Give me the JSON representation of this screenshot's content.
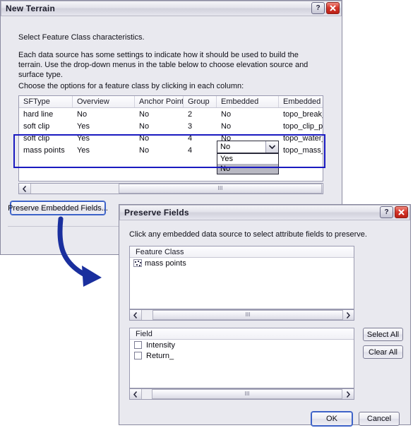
{
  "new_terrain": {
    "title": "New Terrain",
    "help_icon": "help-icon",
    "close_icon": "close-icon",
    "intro_line": "Select Feature Class characteristics.",
    "paragraph": "Each data source has some settings to indicate how it should be used to build the terrain.  Use the drop-down menus in the table below to choose elevation source and surface type.",
    "instruction": "Choose the options for a feature class by clicking in each column:",
    "table": {
      "columns": [
        "SFType",
        "Overview",
        "Anchor Points",
        "Group",
        "Embedded",
        "Embedded Name"
      ],
      "rows": [
        [
          "hard line",
          "No",
          "No",
          "2",
          "No",
          "topo_break_lines_embed"
        ],
        [
          "soft clip",
          "Yes",
          "No",
          "3",
          "No",
          "topo_clip_poly_embed"
        ],
        [
          "soft clip",
          "Yes",
          "No",
          "4",
          "No",
          "topo_water_poly_embed"
        ],
        [
          "mass points",
          "Yes",
          "No",
          "4",
          "",
          "topo_mass_points_embed"
        ]
      ]
    },
    "embedded_combo": {
      "value": "No",
      "arrow_icon": "chevron-down-icon",
      "options": [
        "Yes",
        "No"
      ],
      "selected_option": "No"
    },
    "scrollbar": {
      "left_icon": "chevron-left-icon",
      "right_icon": "chevron-right-icon",
      "grip": "III"
    },
    "preserve_button": "Preserve Embedded Fields..."
  },
  "preserve_fields": {
    "title": "Preserve Fields",
    "help_icon": "help-icon",
    "close_icon": "close-icon",
    "instruction": "Click any embedded data source to select attribute fields to preserve.",
    "feature_class_list": {
      "header": "Feature Class",
      "items": [
        "mass points"
      ]
    },
    "field_list": {
      "header": "Field",
      "items": [
        {
          "label": "Intensity",
          "checked": false
        },
        {
          "label": "Return_",
          "checked": false
        }
      ]
    },
    "scrollbar": {
      "left_icon": "chevron-left-icon",
      "right_icon": "chevron-right-icon",
      "grip": "III"
    },
    "buttons": {
      "select_all": "Select All",
      "clear_all": "Clear All",
      "ok": "OK",
      "cancel": "Cancel"
    }
  },
  "annotations": {
    "highlight_box_color": "#1a1ac0",
    "arrow_color": "#1a2f9e"
  }
}
